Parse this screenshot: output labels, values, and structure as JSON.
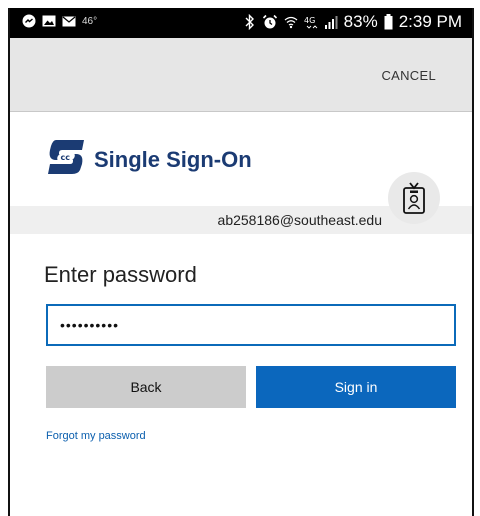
{
  "status_bar": {
    "temperature": "46°",
    "battery": "83%",
    "time": "2:39 PM",
    "icons": [
      "messenger-icon",
      "gallery-icon",
      "mail-icon",
      "bluetooth-icon",
      "alarm-icon",
      "wifi-icon",
      "4g-icon",
      "signal-icon",
      "battery-icon"
    ]
  },
  "action_bar": {
    "cancel_label": "CANCEL"
  },
  "brand": {
    "title": "Single Sign-On",
    "logo_color": "#1b3b73"
  },
  "account": {
    "email": "ab258186@southeast.edu"
  },
  "form": {
    "heading": "Enter password",
    "password_value": "••••••••••",
    "back_label": "Back",
    "signin_label": "Sign in",
    "forgot_label": "Forgot my password"
  },
  "colors": {
    "primary": "#0b67bd",
    "back": "#cccccc",
    "link": "#0b5fae"
  }
}
